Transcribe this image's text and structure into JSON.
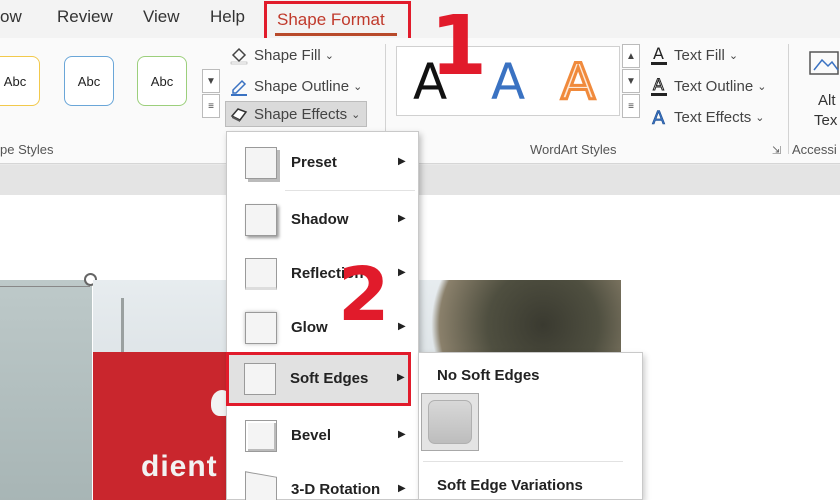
{
  "tabs": {
    "items": [
      "ow",
      "Review",
      "View",
      "Help"
    ],
    "active": "Shape Format"
  },
  "ribbon": {
    "shape_styles": {
      "thumbs": [
        "Abc",
        "Abc",
        "Abc",
        "Abc"
      ],
      "group_label": "pe Styles"
    },
    "commands": {
      "shape_fill": "Shape Fill",
      "shape_outline": "Shape Outline",
      "shape_effects": "Shape Effects",
      "text_fill": "Text Fill",
      "text_outline": "Text Outline",
      "text_effects": "Text Effects"
    },
    "wordart": {
      "glyphs": [
        "A",
        "A",
        "A"
      ],
      "group_label": "WordArt Styles"
    },
    "accessibility": {
      "line1": "Alt",
      "line2": "Tex",
      "group_label": "Accessi"
    }
  },
  "canvas": {
    "brand_text": "dient"
  },
  "annotations": {
    "step1": "1",
    "step2": "2"
  },
  "menu": {
    "items": [
      {
        "label": "Preset"
      },
      {
        "label": "Shadow"
      },
      {
        "label": "Reflection"
      },
      {
        "label": "Glow"
      },
      {
        "label": "Soft Edges"
      },
      {
        "label": "Bevel"
      },
      {
        "label": "3-D Rotation"
      }
    ]
  },
  "submenu": {
    "no_soft_edges": "No Soft Edges",
    "variations": "Soft Edge Variations"
  },
  "colors": {
    "accent_red": "#e11b2b",
    "wordart_blue": "#3a72c2",
    "wordart_orange": "#f08a3c"
  }
}
